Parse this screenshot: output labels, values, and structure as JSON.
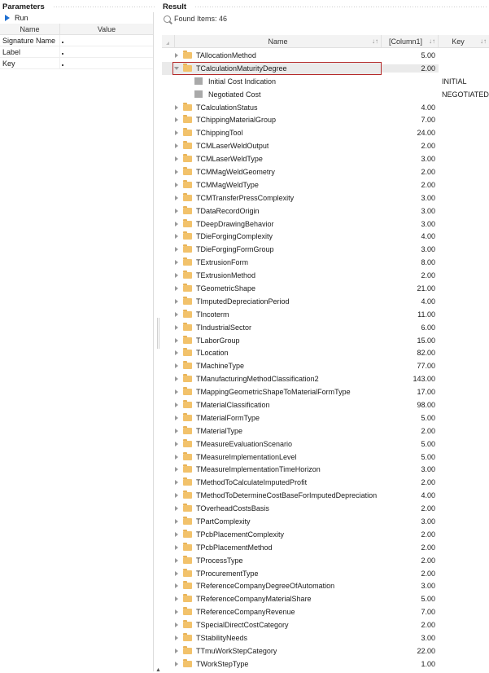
{
  "parameters": {
    "title": "Parameters",
    "run_label": "Run",
    "columns": {
      "name": "Name",
      "value": "Value"
    },
    "rows": [
      {
        "name": "Signature Name",
        "value": ""
      },
      {
        "name": "Label",
        "value": ""
      },
      {
        "name": "Key",
        "value": ""
      }
    ]
  },
  "result": {
    "title": "Result",
    "found_text": "Found Items: 46",
    "columns": {
      "name": "Name",
      "col1": "[Column1]",
      "key": "Key"
    },
    "sort_glyph": "↓↑",
    "rows": [
      {
        "name": "TAllocationMethod",
        "value": "5.00",
        "type": "folder"
      },
      {
        "name": "TCalculationMaturityDegree",
        "value": "2.00",
        "type": "folder",
        "expanded": true,
        "selected": true
      },
      {
        "name": "Initial Cost Indication",
        "value": "",
        "key": "INITIAL",
        "type": "leaf"
      },
      {
        "name": "Negotiated Cost",
        "value": "",
        "key": "NEGOTIATED",
        "type": "leaf"
      },
      {
        "name": "TCalculationStatus",
        "value": "4.00",
        "type": "folder"
      },
      {
        "name": "TChippingMaterialGroup",
        "value": "7.00",
        "type": "folder"
      },
      {
        "name": "TChippingTool",
        "value": "24.00",
        "type": "folder"
      },
      {
        "name": "TCMLaserWeldOutput",
        "value": "2.00",
        "type": "folder"
      },
      {
        "name": "TCMLaserWeldType",
        "value": "3.00",
        "type": "folder"
      },
      {
        "name": "TCMMagWeldGeometry",
        "value": "2.00",
        "type": "folder"
      },
      {
        "name": "TCMMagWeldType",
        "value": "2.00",
        "type": "folder"
      },
      {
        "name": "TCMTransferPressComplexity",
        "value": "3.00",
        "type": "folder"
      },
      {
        "name": "TDataRecordOrigin",
        "value": "3.00",
        "type": "folder"
      },
      {
        "name": "TDeepDrawingBehavior",
        "value": "3.00",
        "type": "folder"
      },
      {
        "name": "TDieForgingComplexity",
        "value": "4.00",
        "type": "folder"
      },
      {
        "name": "TDieForgingFormGroup",
        "value": "3.00",
        "type": "folder"
      },
      {
        "name": "TExtrusionForm",
        "value": "8.00",
        "type": "folder"
      },
      {
        "name": "TExtrusionMethod",
        "value": "2.00",
        "type": "folder"
      },
      {
        "name": "TGeometricShape",
        "value": "21.00",
        "type": "folder"
      },
      {
        "name": "TImputedDepreciationPeriod",
        "value": "4.00",
        "type": "folder"
      },
      {
        "name": "TIncoterm",
        "value": "11.00",
        "type": "folder"
      },
      {
        "name": "TIndustrialSector",
        "value": "6.00",
        "type": "folder"
      },
      {
        "name": "TLaborGroup",
        "value": "15.00",
        "type": "folder"
      },
      {
        "name": "TLocation",
        "value": "82.00",
        "type": "folder"
      },
      {
        "name": "TMachineType",
        "value": "77.00",
        "type": "folder"
      },
      {
        "name": "TManufacturingMethodClassification2",
        "value": "143.00",
        "type": "folder"
      },
      {
        "name": "TMappingGeometricShapeToMaterialFormType",
        "value": "17.00",
        "type": "folder"
      },
      {
        "name": "TMaterialClassification",
        "value": "98.00",
        "type": "folder"
      },
      {
        "name": "TMaterialFormType",
        "value": "5.00",
        "type": "folder"
      },
      {
        "name": "TMaterialType",
        "value": "2.00",
        "type": "folder"
      },
      {
        "name": "TMeasureEvaluationScenario",
        "value": "5.00",
        "type": "folder"
      },
      {
        "name": "TMeasureImplementationLevel",
        "value": "5.00",
        "type": "folder"
      },
      {
        "name": "TMeasureImplementationTimeHorizon",
        "value": "3.00",
        "type": "folder"
      },
      {
        "name": "TMethodToCalculateImputedProfit",
        "value": "2.00",
        "type": "folder"
      },
      {
        "name": "TMethodToDetermineCostBaseForImputedDepreciation",
        "value": "4.00",
        "type": "folder"
      },
      {
        "name": "TOverheadCostsBasis",
        "value": "2.00",
        "type": "folder"
      },
      {
        "name": "TPartComplexity",
        "value": "3.00",
        "type": "folder"
      },
      {
        "name": "TPcbPlacementComplexity",
        "value": "2.00",
        "type": "folder"
      },
      {
        "name": "TPcbPlacementMethod",
        "value": "2.00",
        "type": "folder"
      },
      {
        "name": "TProcessType",
        "value": "2.00",
        "type": "folder"
      },
      {
        "name": "TProcurementType",
        "value": "2.00",
        "type": "folder"
      },
      {
        "name": "TReferenceCompanyDegreeOfAutomation",
        "value": "3.00",
        "type": "folder"
      },
      {
        "name": "TReferenceCompanyMaterialShare",
        "value": "5.00",
        "type": "folder"
      },
      {
        "name": "TReferenceCompanyRevenue",
        "value": "7.00",
        "type": "folder"
      },
      {
        "name": "TSpecialDirectCostCategory",
        "value": "2.00",
        "type": "folder"
      },
      {
        "name": "TStabilityNeeds",
        "value": "3.00",
        "type": "folder"
      },
      {
        "name": "TTmuWorkStepCategory",
        "value": "22.00",
        "type": "folder"
      },
      {
        "name": "TWorkStepType",
        "value": "1.00",
        "type": "folder"
      }
    ]
  },
  "icons": {
    "run": "play-icon",
    "found": "search-icon",
    "folder": "folder-icon",
    "leaf": "item-icon"
  },
  "colors": {
    "accent": "#1f6fd1",
    "selection_border": "#b52a2a",
    "folder": "#f2c26b",
    "leaf_icon": "#a9a9a9"
  }
}
